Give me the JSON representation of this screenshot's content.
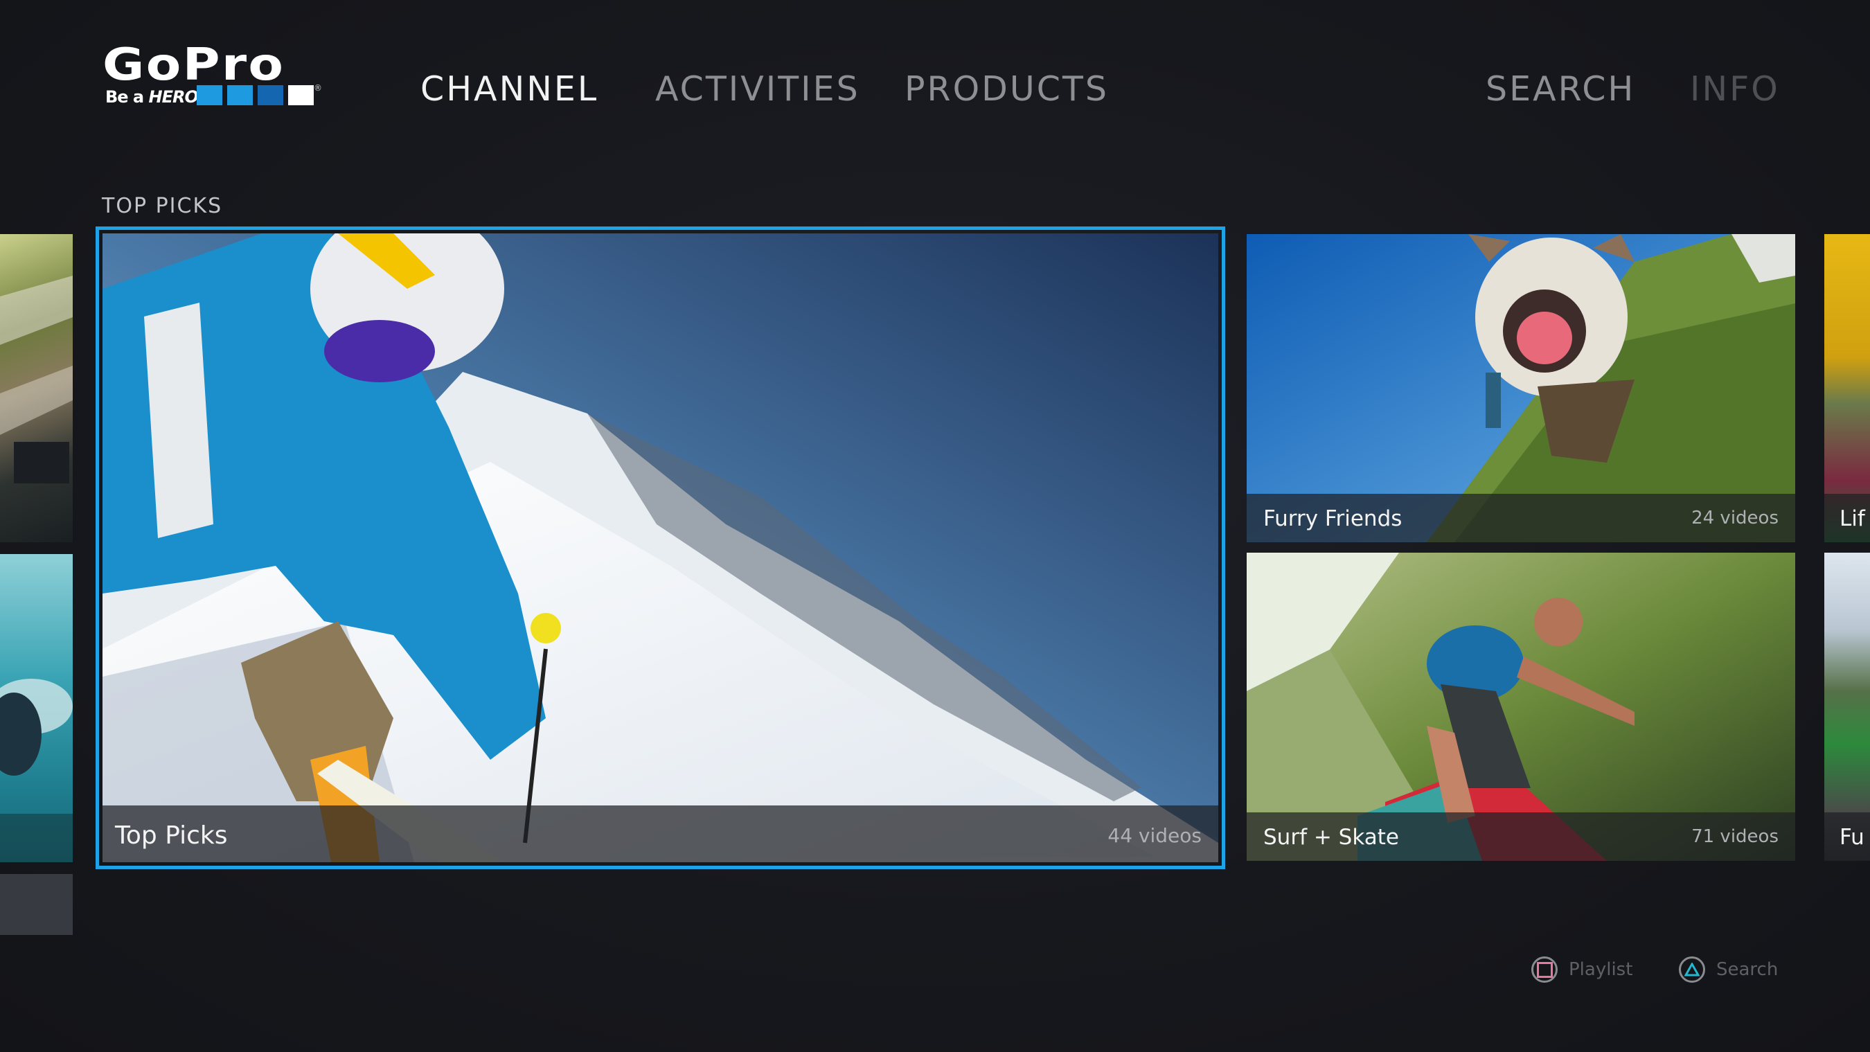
{
  "brand": {
    "logo_text": "GoPro",
    "registered": "®",
    "tagline_prefix": "Be a ",
    "tagline_hero": "HERO.",
    "squares": [
      "#1e9be0",
      "#1e9be0",
      "#1566b0",
      "#ffffff"
    ]
  },
  "nav": {
    "items": [
      {
        "label": "CHANNEL",
        "state": "active"
      },
      {
        "label": "ACTIVITIES",
        "state": "idle"
      },
      {
        "label": "PRODUCTS",
        "state": "idle"
      }
    ],
    "right_items": [
      {
        "label": "SEARCH",
        "state": "idle"
      },
      {
        "label": "INFO",
        "state": "disabled"
      }
    ]
  },
  "section": {
    "label": "TOP PICKS"
  },
  "tiles": {
    "left_partial_top": {
      "label": ""
    },
    "left_partial_bottom": {
      "label": ""
    },
    "featured": {
      "title": "Top Picks",
      "count": "44 videos"
    },
    "furry_friends": {
      "title": "Furry Friends",
      "count": "24 videos"
    },
    "surf_skate": {
      "title": "Surf + Skate",
      "count": "71 videos"
    },
    "right_partial_top": {
      "title": "Lif"
    },
    "right_partial_bottom": {
      "title": "Fu"
    }
  },
  "hints": [
    {
      "icon": "square-button-icon",
      "label": "Playlist",
      "color": "#e8789c"
    },
    {
      "icon": "triangle-button-icon",
      "label": "Search",
      "color": "#25b7cf"
    }
  ],
  "colors": {
    "accent": "#1ea3e6",
    "background": "#17181d"
  }
}
